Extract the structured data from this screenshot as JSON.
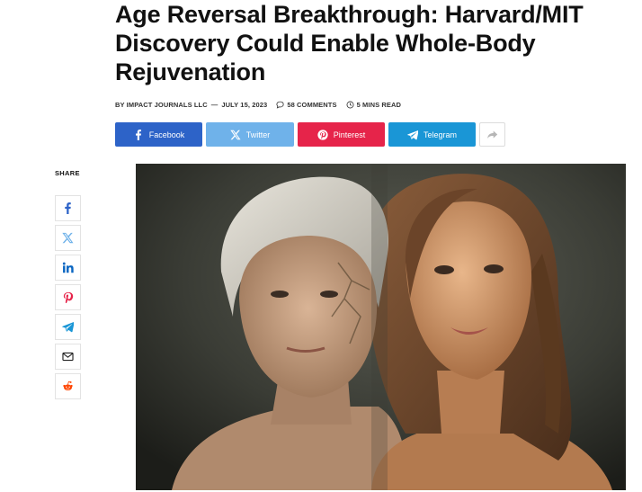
{
  "article": {
    "title": "Age Reversal Breakthrough: Harvard/MIT Discovery Could Enable Whole-Body Rejuvenation",
    "byline": "BY IMPACT JOURNALS LLC",
    "date": "JULY 15, 2023",
    "comments": "58 COMMENTS",
    "read_time": "5 MINS READ"
  },
  "share_buttons": [
    {
      "label": "Facebook",
      "icon": "facebook-icon",
      "color": "#2d63c8"
    },
    {
      "label": "Twitter",
      "icon": "x-icon",
      "color": "#6fb2ea"
    },
    {
      "label": "Pinterest",
      "icon": "pinterest-icon",
      "color": "#e6244a"
    },
    {
      "label": "Telegram",
      "icon": "telegram-icon",
      "color": "#1a96d6"
    }
  ],
  "more_share_icon": "share-arrow-icon",
  "sidebar": {
    "label": "SHARE",
    "icons": [
      "facebook-icon",
      "x-icon",
      "linkedin-icon",
      "pinterest-icon",
      "telegram-icon",
      "email-icon",
      "reddit-icon"
    ]
  },
  "hero_image": {
    "description_icon": "hero-image"
  }
}
